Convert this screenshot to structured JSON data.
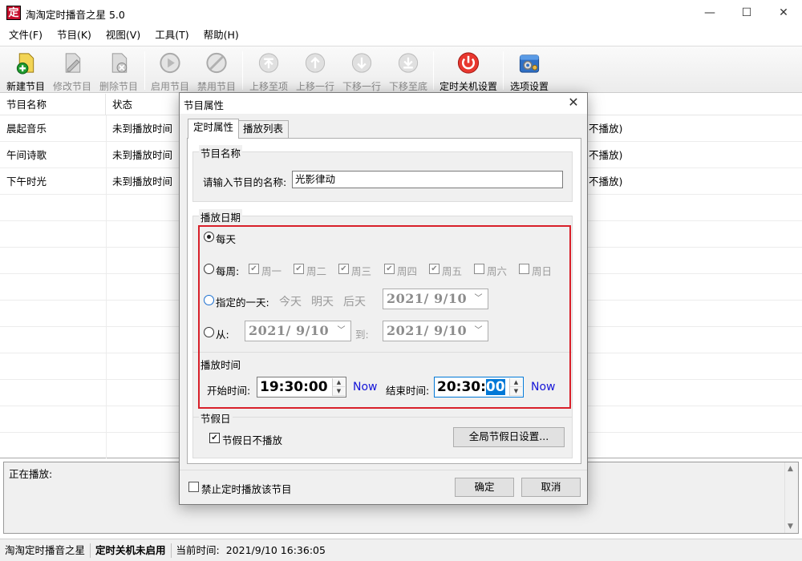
{
  "window": {
    "title": "淘淘定时播音之星 5.0",
    "icon_char": "定",
    "controls": {
      "minimize": "—",
      "maximize": "☐",
      "close": "✕"
    }
  },
  "menu": [
    "文件(F)",
    "节目(K)",
    "视图(V)",
    "工具(T)",
    "帮助(H)"
  ],
  "toolbar": {
    "new": "新建节目",
    "edit": "修改节目",
    "delete": "删除节目",
    "enable": "启用节目",
    "disable": "禁用节目",
    "move_top": "上移至项",
    "move_up": "上移一行",
    "move_down": "下移一行",
    "move_bottom": "下移至底",
    "shutdown": "定时关机设置",
    "options": "选项设置"
  },
  "list": {
    "columns": [
      "节目名称",
      "状态"
    ],
    "rows": [
      {
        "name": "晨起音乐",
        "status": "未到播放时间",
        "tail": "不播放)"
      },
      {
        "name": "午间诗歌",
        "status": "未到播放时间",
        "tail": "不播放)"
      },
      {
        "name": "下午时光",
        "status": "未到播放时间",
        "tail": "不播放)"
      }
    ]
  },
  "now_playing": {
    "label": "正在播放:"
  },
  "status": {
    "app": "淘淘定时播音之星",
    "shutdown": "定时关机未启用",
    "time_label": "当前时间:",
    "time_value": "2021/9/10 16:36:05"
  },
  "dialog": {
    "title": "节目属性",
    "close": "✕",
    "tabs": [
      "定时属性",
      "播放列表"
    ],
    "name_group": {
      "title": "节目名称",
      "label": "请输入节目的名称:",
      "value": "光影律动"
    },
    "date_group": {
      "title": "播放日期",
      "daily": "每天",
      "weekly": "每周:",
      "weekdays": [
        {
          "label": "周一",
          "checked": true
        },
        {
          "label": "周二",
          "checked": true
        },
        {
          "label": "周三",
          "checked": true
        },
        {
          "label": "周四",
          "checked": true
        },
        {
          "label": "周五",
          "checked": true
        },
        {
          "label": "周六",
          "checked": false
        },
        {
          "label": "周日",
          "checked": false
        }
      ],
      "specific_day": "指定的一天:",
      "today": "今天",
      "tomorrow": "明天",
      "day_after": "后天",
      "specific_date": "2021/  9/10",
      "from": "从:",
      "from_date": "2021/  9/10",
      "to": "到:",
      "to_date": "2021/  9/10"
    },
    "time_group": {
      "title": "播放时间",
      "start_label": "开始时间:",
      "start_value": "19:30:00",
      "now": "Now",
      "end_label": "结束时间:",
      "end_value_main": "20:30:",
      "end_value_sel": "00"
    },
    "holiday_group": {
      "title": "节假日",
      "no_play": "节假日不播放",
      "settings_button": "全局节假日设置..."
    },
    "disable_check": "禁止定时播放该节目",
    "ok": "确定",
    "cancel": "取消"
  },
  "colors": {
    "highlight_box": "#d8202a",
    "link": "#1515d8",
    "selection": "#0078d7"
  }
}
